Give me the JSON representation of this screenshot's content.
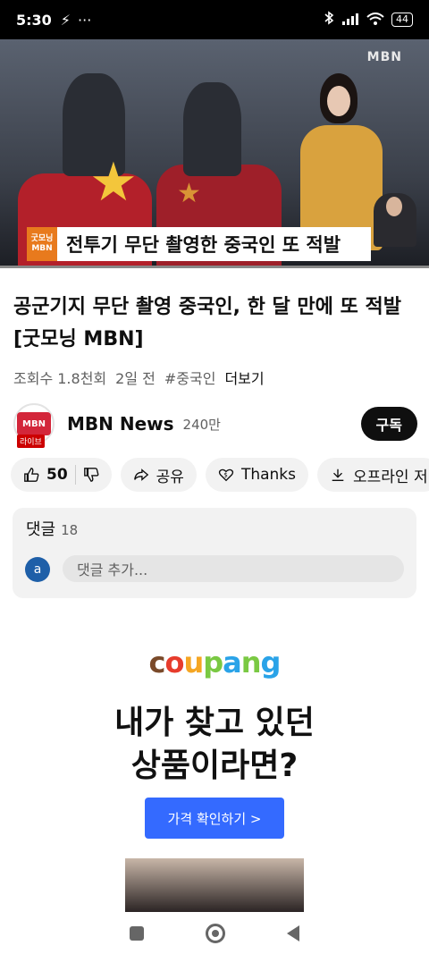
{
  "status_bar": {
    "time": "5:30",
    "dots": "···",
    "battery": "44"
  },
  "video": {
    "watermark": "MBN",
    "caption_badge_top": "굿모닝",
    "caption_badge_bottom": "MBN",
    "caption": "전투기 무단 촬영한 중국인 또 적발"
  },
  "title": "공군기지 무단 촬영 중국인, 한 달 만에 또 적발 [굿모닝 MBN]",
  "meta": {
    "views": "조회수 1.8천회",
    "age": "2일 전",
    "hashtag": "#중국인",
    "more": "더보기"
  },
  "channel": {
    "avatar_text": "MBN",
    "live_label": "라이브",
    "name": "MBN News",
    "subscribers": "240만",
    "subscribe_label": "구독"
  },
  "actions": {
    "likes": "50",
    "share": "공유",
    "thanks": "Thanks",
    "offline": "오프라인 저"
  },
  "comments": {
    "heading": "댓글",
    "count": "18",
    "avatar_letter": "a",
    "placeholder": "댓글 추가..."
  },
  "ad": {
    "brand": [
      "c",
      "o",
      "u",
      "p",
      "a",
      "n",
      "g"
    ],
    "headline_1": "내가 찾고 있던",
    "headline_2": "상품이라면?",
    "cta": "가격 확인하기 >"
  },
  "colors": {
    "subscribe_bg": "#0f0f0f",
    "ad_button": "#346aff",
    "caption_badge": "#e87a1d"
  }
}
